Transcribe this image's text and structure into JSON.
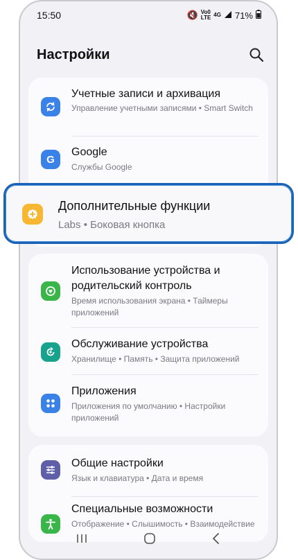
{
  "status": {
    "time": "15:50",
    "battery": "71%",
    "volte": "Vo0",
    "lte": "LTE",
    "signal": "4G"
  },
  "header": {
    "title": "Настройки"
  },
  "items": [
    {
      "title": "Учетные записи и архивация",
      "subtitle": "Управление учетными записями • Smart Switch",
      "icon": "sync-icon",
      "color": "#3b82e8"
    },
    {
      "title": "Google",
      "subtitle": "Службы Google",
      "icon": "google-icon",
      "color": "#3b82e8"
    },
    {
      "title": "Дополнительные функции",
      "subtitle": "Labs • Боковая кнопка",
      "icon": "plus-gear-icon",
      "color": "#f7b733"
    },
    {
      "title": "Использование устройства и родительский контроль",
      "subtitle": "Время использования экрана • Таймеры приложений",
      "icon": "wellbeing-icon",
      "color": "#3ab54a"
    },
    {
      "title": "Обслуживание устройства",
      "subtitle": "Хранилище • Память • Защита приложений",
      "icon": "device-care-icon",
      "color": "#17a28e"
    },
    {
      "title": "Приложения",
      "subtitle": "Приложения по умолчанию • Настройки приложений",
      "icon": "apps-icon",
      "color": "#3b82e8"
    },
    {
      "title": "Общие настройки",
      "subtitle": "Язык и клавиатура • Дата и время",
      "icon": "sliders-icon",
      "color": "#5e5fa8"
    },
    {
      "title": "Специальные возможности",
      "subtitle": "Отображение • Слышимость • Взаимодействие",
      "icon": "accessibility-icon",
      "color": "#3ab54a"
    }
  ]
}
